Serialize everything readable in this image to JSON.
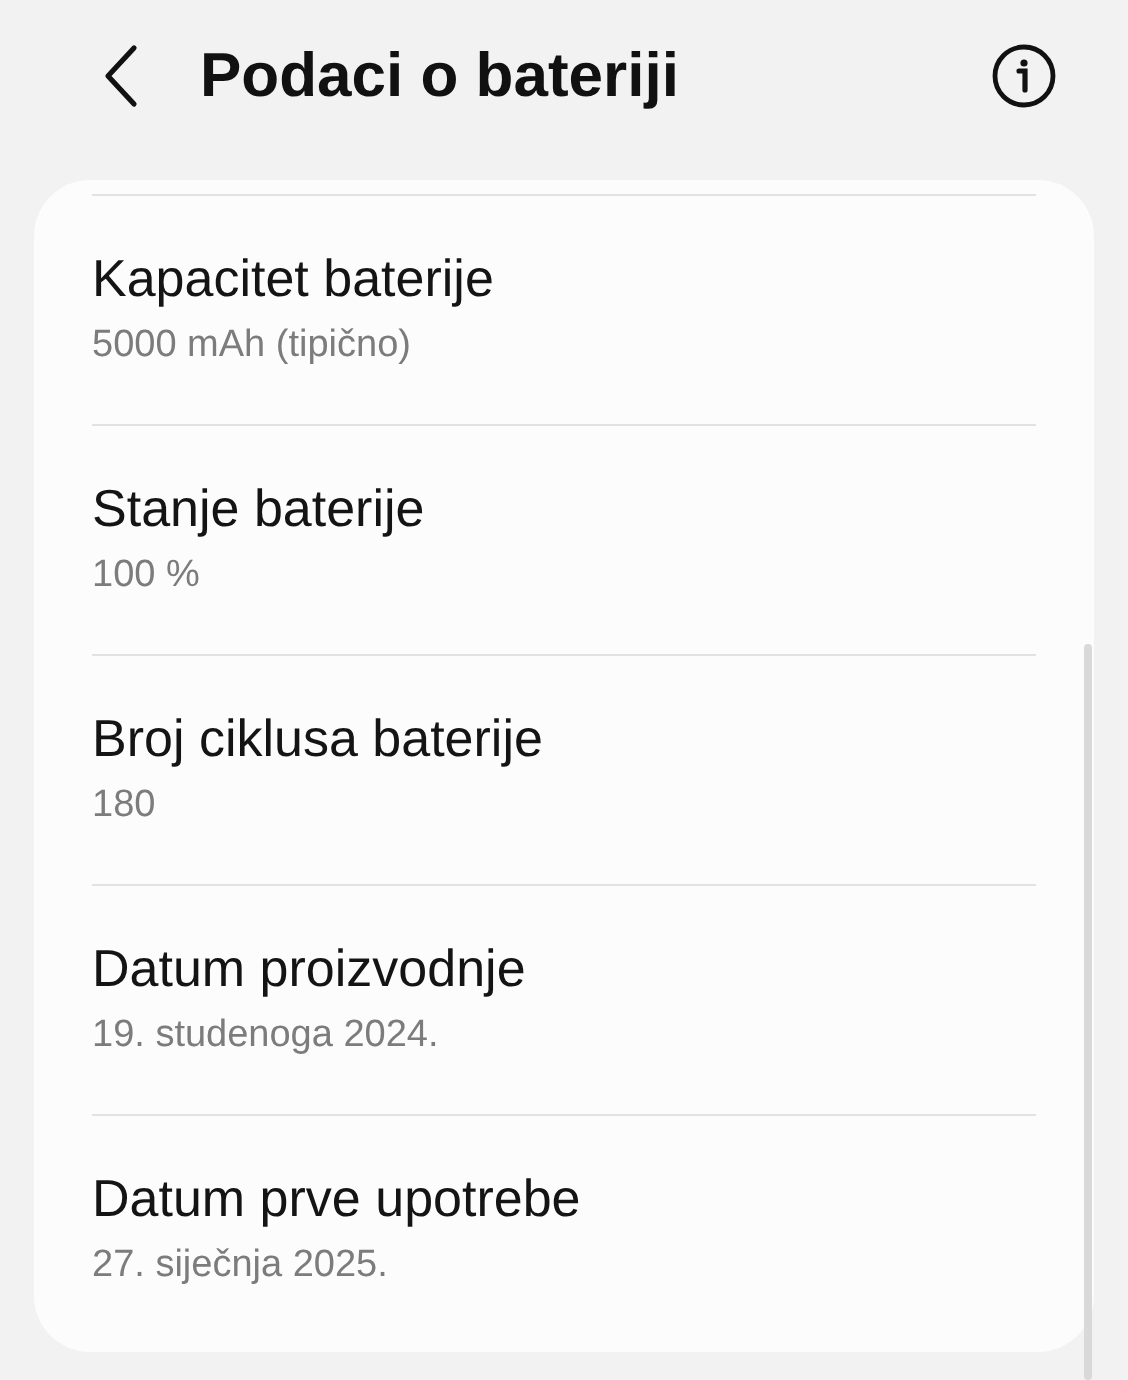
{
  "header": {
    "title": "Podaci o bateriji"
  },
  "rows": [
    {
      "title": "Kapacitet baterije",
      "value": "5000 mAh (tipično)"
    },
    {
      "title": "Stanje baterije",
      "value": "100 %"
    },
    {
      "title": "Broj ciklusa baterije",
      "value": "180"
    },
    {
      "title": "Datum proizvodnje",
      "value": "19. studenoga 2024."
    },
    {
      "title": "Datum prve upotrebe",
      "value": "27. siječnja 2025."
    }
  ]
}
